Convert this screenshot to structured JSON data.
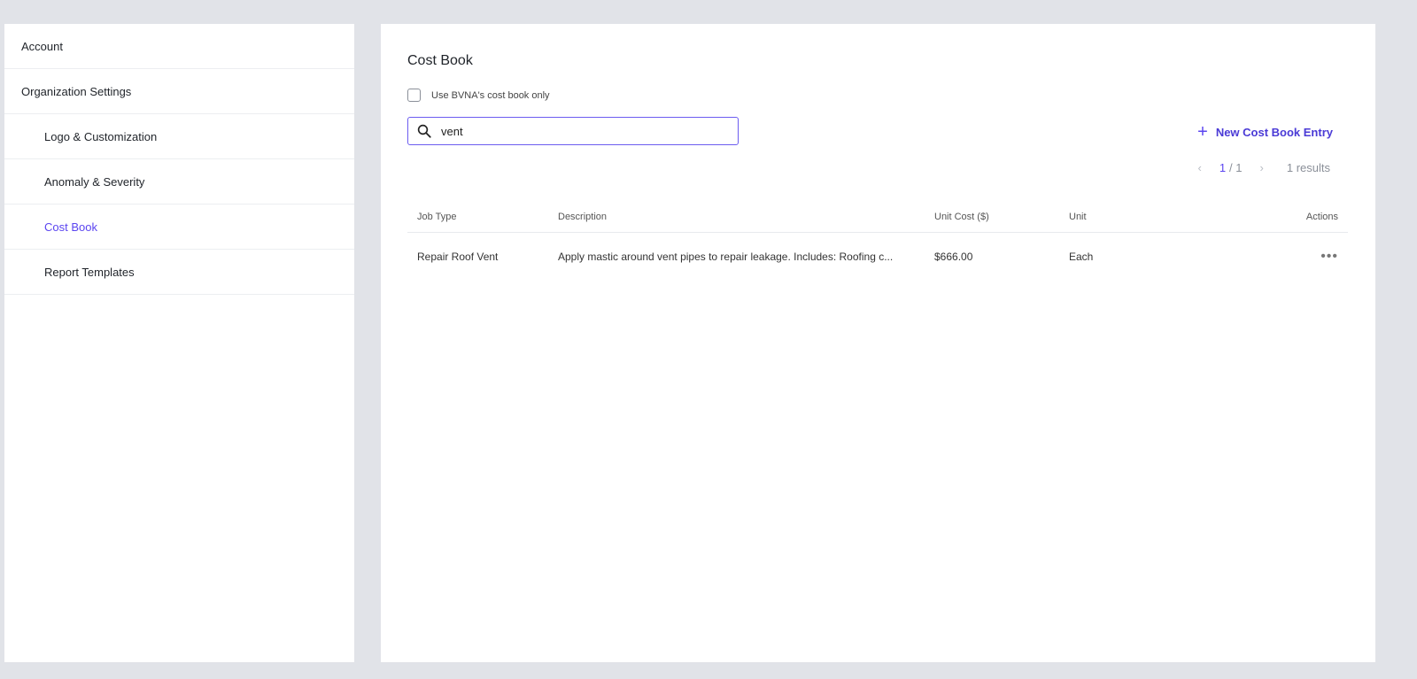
{
  "sidebar": {
    "items": [
      {
        "label": "Account"
      },
      {
        "label": "Organization Settings"
      },
      {
        "label": "Logo & Customization"
      },
      {
        "label": "Anomaly & Severity"
      },
      {
        "label": "Cost Book"
      },
      {
        "label": "Report Templates"
      }
    ],
    "active": "Cost Book"
  },
  "main": {
    "title": "Cost Book",
    "checkbox_label": "Use BVNA's cost book only",
    "checkbox_checked": false,
    "search": {
      "value": "vent",
      "icon": "search-icon"
    },
    "new_button": "New Cost Book Entry",
    "pagination": {
      "current": "1",
      "separator": "/ 1",
      "results": "1 results"
    },
    "table": {
      "headers": [
        "Job Type",
        "Description",
        "Unit Cost ($)",
        "Unit",
        "Actions"
      ],
      "rows": [
        {
          "job_type": "Repair Roof Vent",
          "description": "Apply mastic around vent pipes to repair leakage. Includes: Roofing c...",
          "unit_cost": "$666.00",
          "unit": "Each",
          "actions": "•••"
        }
      ]
    }
  },
  "colors": {
    "accent": "#5b45f0",
    "background": "#e1e3e8"
  }
}
